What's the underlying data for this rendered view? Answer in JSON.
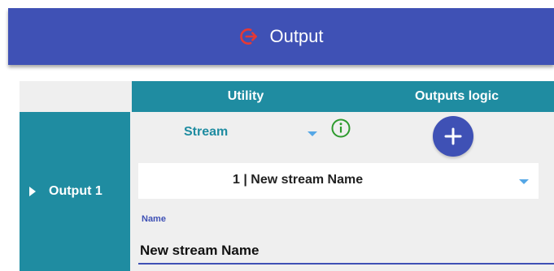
{
  "header": {
    "title": "Output",
    "icon": "logout-icon",
    "accent": "#3f51b5",
    "icon_color": "#e53935"
  },
  "table": {
    "columns": [
      "Utility",
      "Outputs logic"
    ],
    "header_color": "#1f8ca1",
    "row_label": "Output 1"
  },
  "utility": {
    "type_value": "Stream",
    "stream_select_value": "1 | New stream Name",
    "name_label": "Name",
    "name_value": "New stream Name"
  },
  "outputs_logic": {
    "add_icon": "plus-icon"
  },
  "info_icon": "info-icon"
}
